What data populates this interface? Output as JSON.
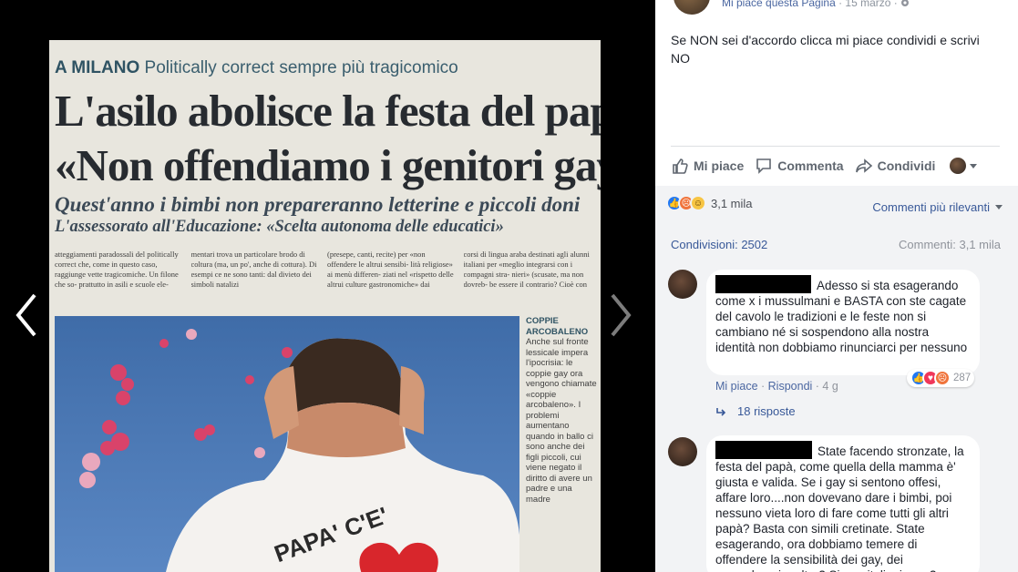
{
  "post": {
    "meta_link": "Mi piace questa Pagina",
    "meta_sep": " · ",
    "meta_date": "15 marzo",
    "text": "Se NON sei d'accordo clicca mi piace condividi e scrivi NO"
  },
  "actions": {
    "like": "Mi piace",
    "comment": "Commenta",
    "share": "Condividi"
  },
  "stats": {
    "reactions_count": "3,1 mila",
    "sort_label": "Commenti più rilevanti",
    "shares": "Condivisioni: 2502",
    "comments": "Commenti: 3,1 mila"
  },
  "comments": [
    {
      "text": "Adesso si sta esagerando come x i mussulmani e BASTA con ste cagate del cavolo le tradizioni e le feste non si cambiano né si sospendono alla nostra identità non dobbiamo rinunciarci per nessuno",
      "like": "Mi piace",
      "reply": "Rispondi",
      "time": "4 g",
      "reactions": "287",
      "replies": "18 risposte"
    },
    {
      "text": "State facendo stronzate, la festa del papà, come quella della mamma è' giusta e valida. Se i gay si sentono offesi, affare loro....non dovevano dare i bimbi, poi nessuno vieta loro di fare come tutti gli altri papà? Basta con simili cretinate. State esagerando, ora dobbiamo temere di offendere la sensibilità dei gay, dei mussulmani e altro? Siamo italiani o no?"
    }
  ],
  "newspaper": {
    "kicker_city": "A MILANO",
    "kicker_text": "Politically correct sempre più tragicomico",
    "headline_1": "L'asilo abolisce la festa del papà",
    "headline_2": "«Non offendiamo i genitori gay»",
    "sub_1": "Quest'anno i bimbi non prepareranno letterine e piccoli doni",
    "sub_2": "L'assessorato all'Educazione: «Scelta autonoma delle educatici»",
    "col_1": "atteggiamenti paradossali del politically correct che, come in questo caso, raggiunge vette tragicomiche. Un filone che so- prattutto in asili e scuole ele-",
    "col_2": "mentari trova un particolare brodo di coltura (ma, un po', anche di cottura). Di esempi ce ne sono tanti: dal divieto dei simboli natalizi",
    "col_3": "(presepe, canti, recite) per «non offendere le altrui sensibi- lità religiose» ai menù differen- ziati nel «rispetto delle altrui culture gastronomiche» dai",
    "col_4": "corsi di lingua araba destinati agli alunni italiani per «meglio integrarsi con i compagni stra- nieri» (scusate, ma non dovreb- be essere il contrario? Cioè con",
    "side_title_1": "COPPIE",
    "side_title_2": "ARCOBALENO",
    "side_text": "Anche sul fronte lessicale impera l'ipocrisia: le coppie gay ora vengono chiamate «coppie arcobaleno». I problemi aumentano quando in ballo ci sono anche dei figli piccoli, cui viene negato il diritto di avere un padre e una madre",
    "shirt_text": "PAPA' C'E'"
  },
  "colors": {
    "link": "#385898",
    "grey_bg": "#f2f3f5",
    "like_blue": "#2078f4"
  }
}
